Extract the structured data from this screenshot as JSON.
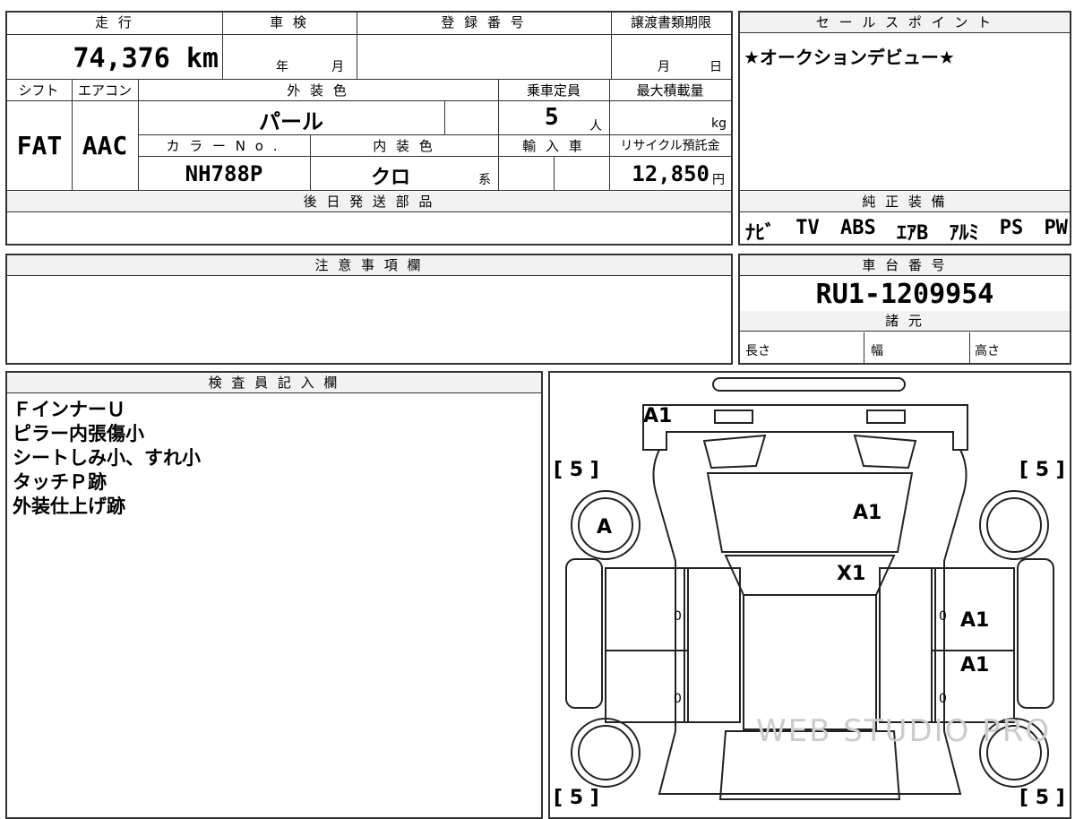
{
  "vehicle": {
    "mileage_label": "走 行",
    "mileage": "74,376 km",
    "inspection_label": "車 検",
    "inspection_year": "年",
    "inspection_month": "月",
    "registration_label": "登 録 番 号",
    "transfer_label": "譲渡書類期限",
    "transfer_month": "月",
    "transfer_day": "日",
    "shift_label": "シフト",
    "shift": "FAT",
    "aircon_label": "エアコン",
    "aircon": "AAC",
    "exterior_color_label": "外 装 色",
    "exterior_color": "パール",
    "capacity_label": "乗車定員",
    "capacity": "5",
    "capacity_unit": "人",
    "max_load_label": "最大積載量",
    "max_load_unit": "kg",
    "color_no_label": "カ ラ ー N o .",
    "color_no": "NH788P",
    "interior_color_label": "内 装 色",
    "interior_color": "クロ",
    "interior_suffix": "系",
    "import_label": "輸 入 車",
    "recycle_label": "リサイクル預託金",
    "recycle_fee": "12,850",
    "recycle_unit": "円",
    "later_parts_label": "後 日 発 送 部 品"
  },
  "sales": {
    "label": "セ ー ル ス ポ イ ン ト",
    "text": "★オークションデビュー★"
  },
  "equipment": {
    "label": "純 正 装 備",
    "items": [
      "ﾅﾋﾞ",
      "TV",
      "ABS",
      "ｴｱB",
      "ｱﾙﾐ",
      "PS",
      "PW"
    ]
  },
  "notes_label": "注 意 事 項 欄",
  "chassis": {
    "label": "車 台 番 号",
    "number": "RU1-1209954",
    "spec_label": "諸 元",
    "length_label": "長さ",
    "width_label": "幅",
    "height_label": "高さ"
  },
  "inspector": {
    "label": "検 査 員 記 入 欄",
    "lines": [
      "ＦインナーＵ",
      "ピラー内張傷小",
      "シートしみ小、すれ小",
      "タッチＰ跡",
      "外装仕上げ跡"
    ]
  },
  "diagram": {
    "marks": {
      "rear_bumper": "A1",
      "roof": "A1",
      "windshield": "X1",
      "right_front_door": "A1",
      "right_rear_door": "A1",
      "left_front_wheel": "A",
      "tire_fl": "[ 5 ]",
      "tire_fr": "[ 5 ]",
      "tire_rl": "[ 5 ]",
      "tire_rr": "[ 5 ]",
      "zero_1": "0",
      "zero_2": "0",
      "zero_3": "0",
      "zero_4": "0"
    },
    "watermark": "WEB STUDIO PRO"
  }
}
